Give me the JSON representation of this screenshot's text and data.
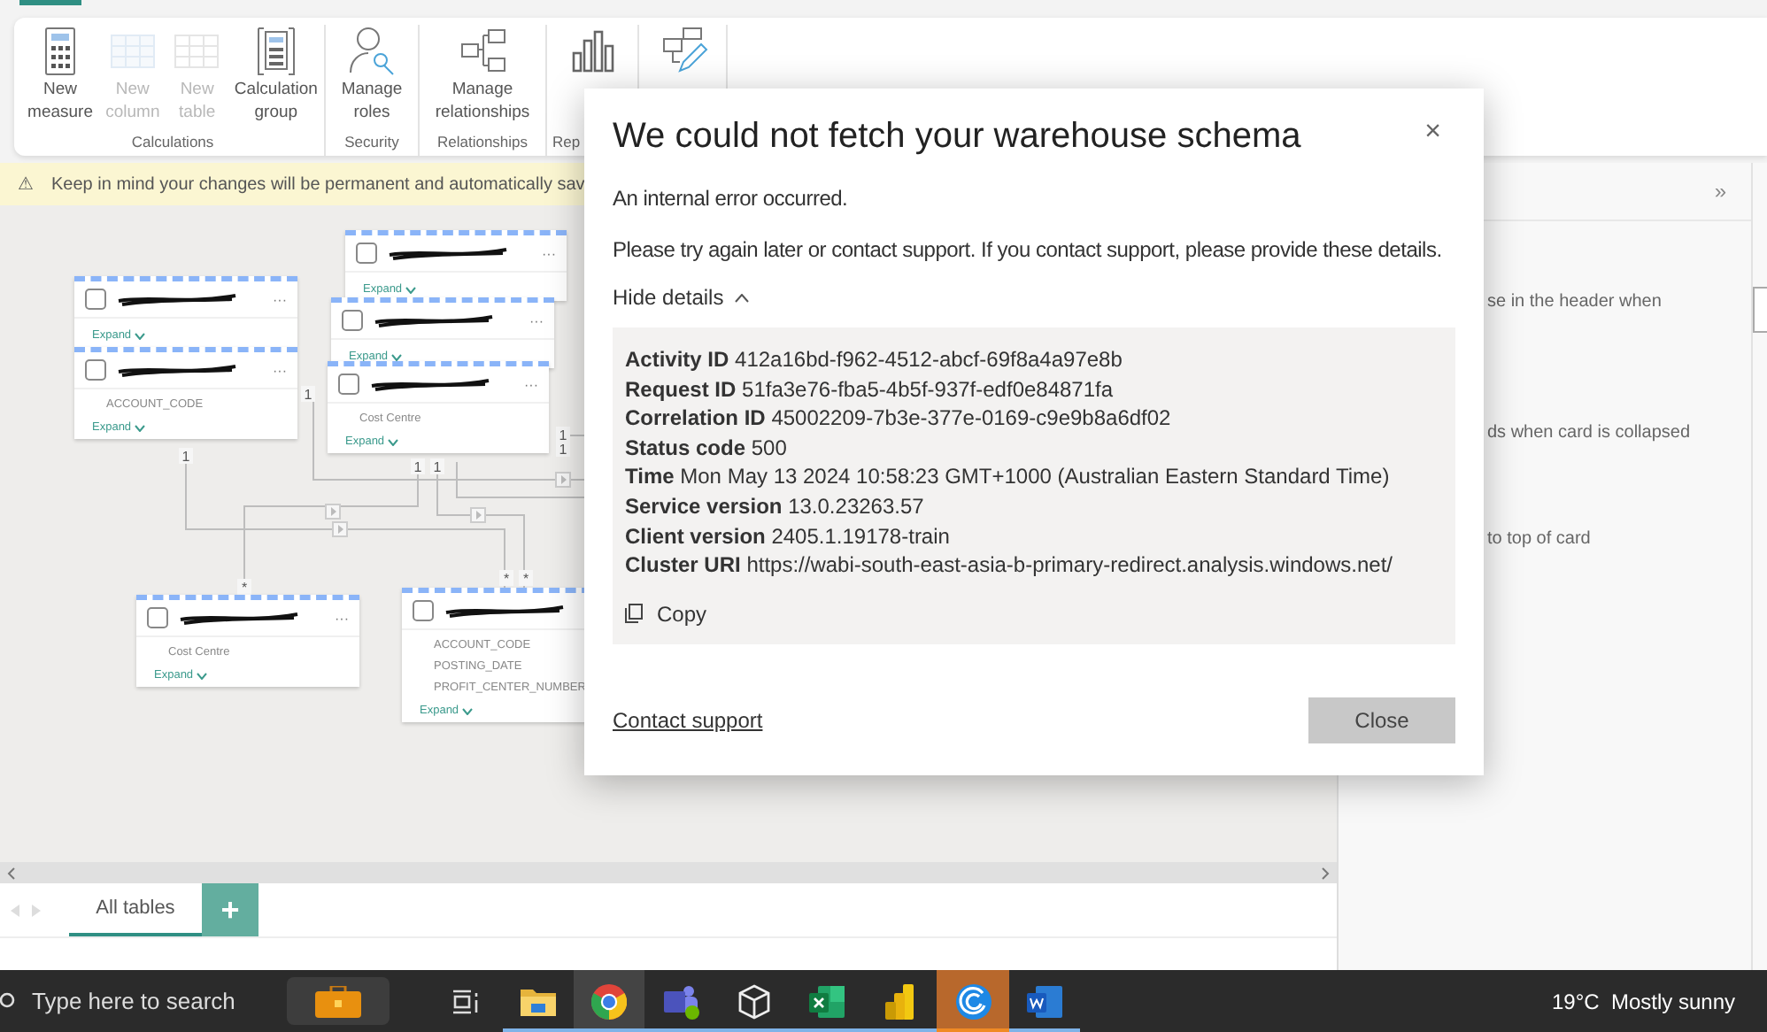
{
  "ribbon": {
    "items": [
      {
        "kind": "calculator",
        "lines": [
          "New",
          "measure"
        ],
        "disabled": false
      },
      {
        "kind": "column",
        "lines": [
          "New",
          "column"
        ],
        "disabled": true
      },
      {
        "kind": "table",
        "lines": [
          "New",
          "table"
        ],
        "disabled": true
      },
      {
        "kind": "calcgroup",
        "lines": [
          "Calculation",
          "group"
        ],
        "disabled": false
      },
      {
        "kind": "roles",
        "lines": [
          "Manage",
          "roles"
        ],
        "disabled": false
      },
      {
        "kind": "relationships",
        "lines": [
          "Manage",
          "relationships"
        ],
        "disabled": false
      },
      {
        "kind": "chart",
        "disabled": false
      },
      {
        "kind": "edit",
        "disabled": false
      }
    ],
    "groups": [
      {
        "label": "Calculations"
      },
      {
        "label": "Security"
      },
      {
        "label": "Relationships"
      },
      {
        "label": "Rep"
      }
    ]
  },
  "warning": {
    "icon": "⚠",
    "text": "Keep in mind your changes will be permanent and automatically sav"
  },
  "diagram": {
    "cards": [
      {
        "expand": "Expand",
        "more": "···"
      },
      {
        "fields": [
          "ACCOUNT_CODE"
        ],
        "expand": "Expand",
        "more": "···"
      },
      {
        "expand": "Expand",
        "more": "···"
      },
      {
        "expand": "Expand",
        "more": "···"
      },
      {
        "fields": [
          "Cost Centre"
        ],
        "expand": "Expand",
        "more": "···"
      },
      {
        "fields": [
          "Cost Centre"
        ],
        "expand": "Expand",
        "more": "···"
      },
      {
        "fields": [
          "ACCOUNT_CODE",
          "POSTING_DATE",
          "PROFIT_CENTER_NUMBER"
        ],
        "expand": "Expand"
      }
    ],
    "cardinality_labels": [
      "1",
      "1",
      "1",
      "1",
      "1",
      "1",
      "*",
      "*",
      "*"
    ]
  },
  "page_tabs": [
    {
      "label": "All tables",
      "selected": true
    }
  ],
  "add_tab": "+",
  "properties_pane": {
    "collapse": "»",
    "texts": [
      "se in the header when",
      "ds when card is collapsed",
      "to top of card"
    ]
  },
  "dialog": {
    "title": "We could not fetch your warehouse schema",
    "close": "×",
    "message": "An internal error occurred.",
    "instruction": "Please try again later or contact support. If you contact support, please provide these details.",
    "details_toggle": "Hide details",
    "expanded": true,
    "details": [
      {
        "label": "Activity ID",
        "value": "412a16bd-f962-4512-abcf-69f8a4a97e8b"
      },
      {
        "label": "Request ID",
        "value": "51fa3e76-fba5-4b5f-937f-edf0e84871fa"
      },
      {
        "label": "Correlation ID",
        "value": "45002209-7b3e-377e-0169-c9e9b8a6df02"
      },
      {
        "label": "Status code",
        "value": "500"
      },
      {
        "label": "Time",
        "value": "Mon May 13 2024 10:58:23 GMT+1000 (Australian Eastern Standard Time)"
      },
      {
        "label": "Service version",
        "value": "13.0.23263.57"
      },
      {
        "label": "Client version",
        "value": "2405.1.19178-train"
      },
      {
        "label": "Cluster URI",
        "value": "https://wabi-south-east-asia-b-primary-redirect.analysis.windows.net/"
      }
    ],
    "copy": "Copy",
    "contact": "Contact support",
    "close_button": "Close"
  },
  "taskbar": {
    "search_placeholder": "Type here to search",
    "apps": [
      {
        "kind": "briefcase",
        "running": false,
        "flashing": false
      },
      {
        "kind": "taskview",
        "running": false,
        "flashing": false
      },
      {
        "kind": "folder",
        "running": true,
        "flashing": false
      },
      {
        "kind": "chrome",
        "running": true,
        "flashing": false
      },
      {
        "kind": "teams",
        "running": true,
        "flashing": false
      },
      {
        "kind": "cube",
        "running": true,
        "flashing": false
      },
      {
        "kind": "excel",
        "running": true,
        "flashing": false
      },
      {
        "kind": "powerbi",
        "running": true,
        "flashing": false
      },
      {
        "kind": "swirl",
        "running": true,
        "flashing": true
      },
      {
        "kind": "word",
        "running": true,
        "flashing": false
      }
    ],
    "weather": "19°C  Mostly sunny"
  }
}
